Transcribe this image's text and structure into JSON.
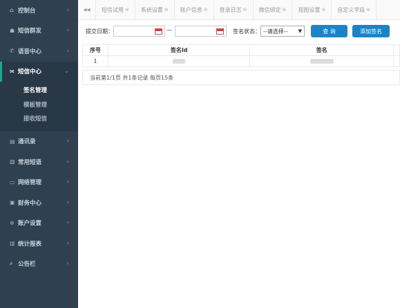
{
  "sidebar": {
    "items": [
      {
        "label": "控制台",
        "icon": "home-icon",
        "glyph": "⌂"
      },
      {
        "label": "短信群发",
        "icon": "group-icon",
        "glyph": "☗"
      },
      {
        "label": "语音中心",
        "icon": "phone-icon",
        "glyph": "✆"
      },
      {
        "label": "短信中心",
        "icon": "envelope-icon",
        "glyph": "✉",
        "expanded": true
      },
      {
        "label": "通讯录",
        "icon": "book-icon",
        "glyph": "▤"
      },
      {
        "label": "常用短语",
        "icon": "file-icon",
        "glyph": "▧"
      },
      {
        "label": "网络管理",
        "icon": "monitor-icon",
        "glyph": "▭"
      },
      {
        "label": "财务中心",
        "icon": "money-icon",
        "glyph": "▣"
      },
      {
        "label": "账户设置",
        "icon": "gear-icon",
        "glyph": "✲"
      },
      {
        "label": "统计报表",
        "icon": "chart-icon",
        "glyph": "▥"
      },
      {
        "label": "公告栏",
        "icon": "search-icon",
        "glyph": "⌕"
      }
    ],
    "subitems": [
      {
        "label": "签名管理",
        "current": true
      },
      {
        "label": "模板管理",
        "current": false
      },
      {
        "label": "接收短信",
        "current": false
      }
    ],
    "chevron_right": "‹",
    "chevron_down": "⌄"
  },
  "tabs": {
    "back_glyph": "◂◂",
    "close_glyph": "⊗",
    "items": [
      "短信试用",
      "系统设置",
      "账户信息",
      "登录日志",
      "微信绑定",
      "视图设置",
      "自定义字段"
    ]
  },
  "filter": {
    "date_label": "提交日期：",
    "dash": "—",
    "status_label": "签名状态：",
    "status_selected": "--请选择--",
    "status_arrow": "▼",
    "search_button": "查 询",
    "add_button": "添加签名"
  },
  "table": {
    "headers": [
      "序号",
      "签名Id",
      "签名"
    ],
    "rows": [
      [
        "1"
      ]
    ]
  },
  "pagination": {
    "text": "当前第1/1页 共1条记录 每页15条"
  },
  "colors": {
    "sidebar_bg": "#2f4050",
    "active_border": "#19aa8d",
    "button_blue": "#1c84c6"
  }
}
